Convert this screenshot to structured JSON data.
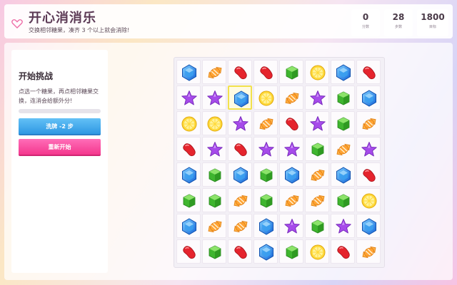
{
  "header": {
    "title": "开心消消乐",
    "subtitle": "交换相邻糖果，凑齐 3 个以上就会消除!",
    "logo_icon": "heart-icon"
  },
  "stats": [
    {
      "id": "score",
      "value": "0",
      "label": "分数"
    },
    {
      "id": "moves",
      "value": "28",
      "label": "步数"
    },
    {
      "id": "target",
      "value": "1800",
      "label": "目标"
    }
  ],
  "side": {
    "title": "开始挑战",
    "description": "点选一个糖果，再点相邻糖果交换，连消会给额外分!",
    "progress": 0,
    "shuffle_label": "洗牌 -2 步",
    "restart_label": "重新开始"
  },
  "board": {
    "rows": 8,
    "cols": 8,
    "selected": [
      1,
      2
    ],
    "grid": [
      [
        "blue-gem",
        "wrapped-candy",
        "red-jellybean",
        "red-jellybean",
        "green-cube",
        "lemon-slice",
        "blue-gem",
        "red-jellybean"
      ],
      [
        "purple-star",
        "purple-star",
        "blue-gem",
        "lemon-slice",
        "wrapped-candy",
        "purple-star",
        "green-cube",
        "blue-gem"
      ],
      [
        "lemon-slice",
        "lemon-slice",
        "purple-star",
        "wrapped-candy",
        "red-jellybean",
        "purple-star",
        "green-cube",
        "wrapped-candy"
      ],
      [
        "red-jellybean",
        "purple-star",
        "red-jellybean",
        "purple-star",
        "purple-star",
        "green-cube",
        "wrapped-candy",
        "purple-star"
      ],
      [
        "blue-gem",
        "green-cube",
        "blue-gem",
        "green-cube",
        "blue-gem",
        "wrapped-candy",
        "blue-gem",
        "red-jellybean"
      ],
      [
        "green-cube",
        "green-cube",
        "wrapped-candy",
        "green-cube",
        "wrapped-candy",
        "wrapped-candy",
        "green-cube",
        "lemon-slice"
      ],
      [
        "blue-gem",
        "wrapped-candy",
        "wrapped-candy",
        "blue-gem",
        "purple-star",
        "green-cube",
        "purple-star",
        "blue-gem"
      ],
      [
        "red-jellybean",
        "green-cube",
        "red-jellybean",
        "blue-gem",
        "green-cube",
        "lemon-slice",
        "red-jellybean",
        "wrapped-candy"
      ]
    ]
  },
  "colors": {
    "accent_pink": "#f4378d",
    "accent_blue": "#2f98e3",
    "selected_outline": "#f2e14d"
  }
}
